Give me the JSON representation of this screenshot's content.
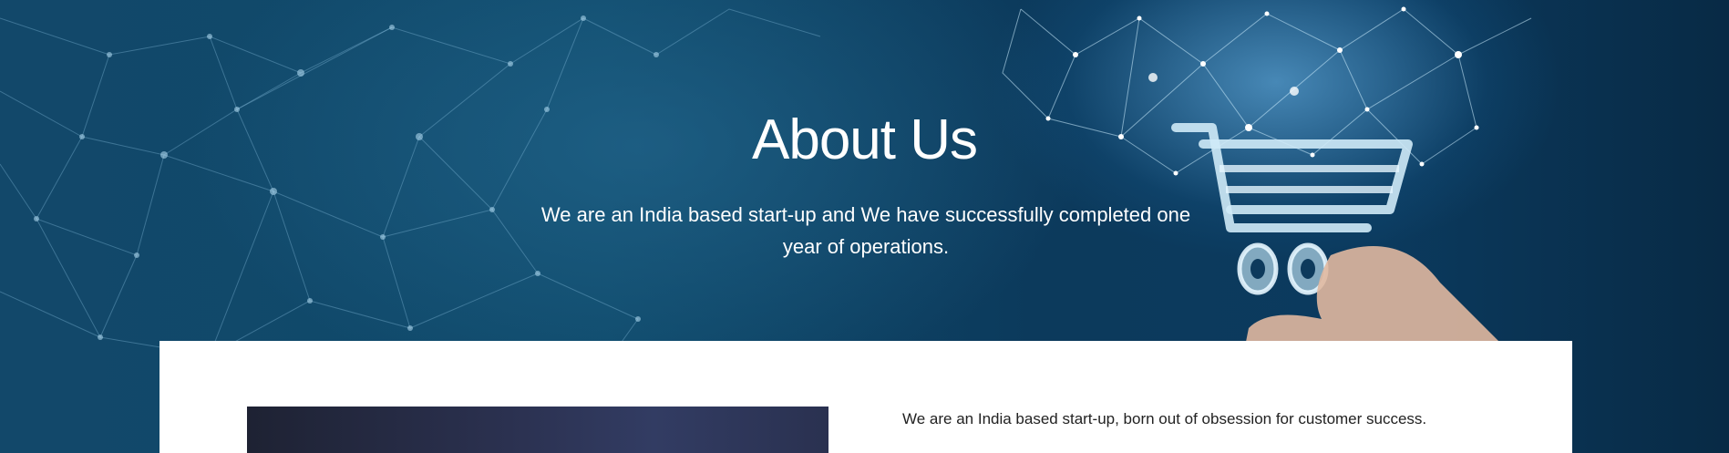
{
  "hero": {
    "title": "About Us",
    "subtitle": "We are an India based start-up and We have successfully completed one year of operations."
  },
  "about": {
    "intro_text": "We are an India based start-up, born out of obsession for customer success."
  },
  "colors": {
    "hero_background": "#0d3a5c",
    "network_lines": "#8fc6e6",
    "card_background": "#ffffff",
    "body_text": "#222222",
    "image_dark": "#2b3150"
  },
  "icons": [
    "shopping-cart-icon",
    "hand-icon",
    "network-background"
  ]
}
